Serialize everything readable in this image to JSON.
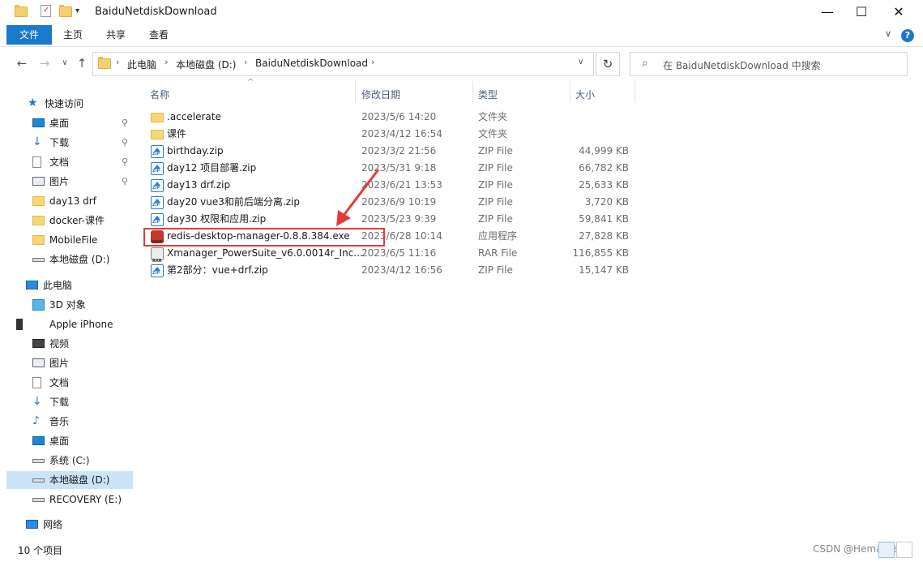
{
  "window": {
    "title": "BaiduNetdiskDownload",
    "minimize": "—",
    "maximize": "☐",
    "close": "✕"
  },
  "ribbon": {
    "tabs": [
      "文件",
      "主页",
      "共享",
      "查看"
    ],
    "help": "?"
  },
  "address": {
    "crumbs": [
      "此电脑",
      "本地磁盘 (D:)",
      "BaiduNetdiskDownload"
    ],
    "search_placeholder": "在 BaiduNetdiskDownload 中搜索"
  },
  "navpane": {
    "quick_access": {
      "label": "快速访问",
      "items": [
        {
          "label": "桌面",
          "icon": "desktop-icon",
          "pinned": true
        },
        {
          "label": "下载",
          "icon": "download-icon",
          "pinned": true
        },
        {
          "label": "文档",
          "icon": "document-icon",
          "pinned": true
        },
        {
          "label": "图片",
          "icon": "picture-icon",
          "pinned": true
        },
        {
          "label": "day13 drf",
          "icon": "folder-icon",
          "pinned": false
        },
        {
          "label": "docker-课件",
          "icon": "folder-icon",
          "pinned": false
        },
        {
          "label": "MobileFile",
          "icon": "folder-icon",
          "pinned": false
        },
        {
          "label": "本地磁盘 (D:)",
          "icon": "drive-icon",
          "pinned": false
        }
      ]
    },
    "this_pc": {
      "label": "此电脑",
      "items": [
        {
          "label": "3D 对象",
          "icon": "3d-objects-icon"
        },
        {
          "label": "Apple iPhone",
          "icon": "phone-icon"
        },
        {
          "label": "视频",
          "icon": "video-icon"
        },
        {
          "label": "图片",
          "icon": "picture-icon"
        },
        {
          "label": "文档",
          "icon": "document-icon"
        },
        {
          "label": "下载",
          "icon": "download-icon"
        },
        {
          "label": "音乐",
          "icon": "music-icon"
        },
        {
          "label": "桌面",
          "icon": "desktop-icon"
        },
        {
          "label": "系统 (C:)",
          "icon": "drive-icon"
        },
        {
          "label": "本地磁盘 (D:)",
          "icon": "drive-icon",
          "selected": true
        },
        {
          "label": "RECOVERY (E:)",
          "icon": "drive-icon"
        }
      ]
    },
    "network": {
      "label": "网络"
    }
  },
  "filelist": {
    "columns": [
      "名称",
      "修改日期",
      "类型",
      "大小"
    ],
    "rows": [
      {
        "name": ".accelerate",
        "date": "2023/5/6 14:20",
        "type": "文件夹",
        "size": "",
        "icon": "folder"
      },
      {
        "name": "课件",
        "date": "2023/4/12 16:54",
        "type": "文件夹",
        "size": "",
        "icon": "folder"
      },
      {
        "name": "birthday.zip",
        "date": "2023/3/2 21:56",
        "type": "ZIP File",
        "size": "44,999 KB",
        "icon": "zip"
      },
      {
        "name": "day12 项目部署.zip",
        "date": "2023/5/31 9:18",
        "type": "ZIP File",
        "size": "66,782 KB",
        "icon": "zip"
      },
      {
        "name": "day13 drf.zip",
        "date": "2023/6/21 13:53",
        "type": "ZIP File",
        "size": "25,633 KB",
        "icon": "zip"
      },
      {
        "name": "day20 vue3和前后端分离.zip",
        "date": "2023/6/9 10:19",
        "type": "ZIP File",
        "size": "3,720 KB",
        "icon": "zip"
      },
      {
        "name": "day30 权限和应用.zip",
        "date": "2023/5/23 9:39",
        "type": "ZIP File",
        "size": "59,841 KB",
        "icon": "zip"
      },
      {
        "name": "redis-desktop-manager-0.8.8.384.exe",
        "date": "2023/6/28 10:14",
        "type": "应用程序",
        "size": "27,828 KB",
        "icon": "exe"
      },
      {
        "name": "Xmanager_PowerSuite_v6.0.0014r_Inc...",
        "date": "2023/6/5 11:16",
        "type": "RAR File",
        "size": "116,855 KB",
        "icon": "rar"
      },
      {
        "name": "第2部分：vue+drf.zip",
        "date": "2023/4/12 16:56",
        "type": "ZIP File",
        "size": "15,147 KB",
        "icon": "zip"
      }
    ]
  },
  "status": {
    "count": "10 个项目",
    "watermark": "CSDN @Hemameba"
  },
  "colors": {
    "accent": "#1979ca",
    "annotation": "#e53a3a"
  }
}
